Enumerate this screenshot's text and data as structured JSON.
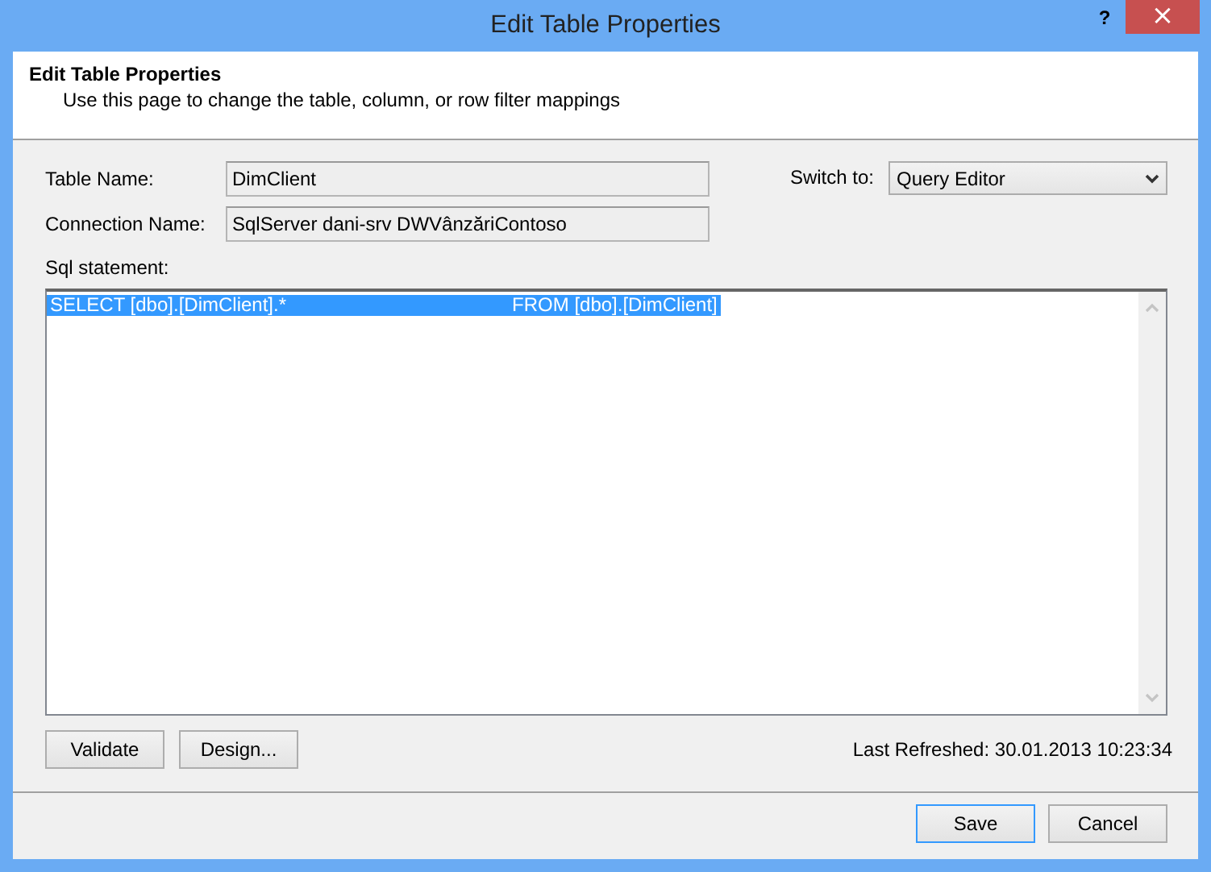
{
  "window": {
    "title": "Edit Table Properties",
    "help": "?",
    "close": "×"
  },
  "header": {
    "title": "Edit Table Properties",
    "subtitle": "Use this page to change the table, column, or row filter mappings"
  },
  "fields": [
    {
      "label": "Table Name:",
      "value": "DimClient"
    },
    {
      "label": "Connection Name:",
      "value": "SqlServer dani-srv DWVânzăriContoso"
    }
  ],
  "switch_to": {
    "label": "Switch to:",
    "value": "Query Editor"
  },
  "sql": {
    "label": "Sql statement:",
    "lines": [
      {
        "text": "SELECT [dbo].[DimClient].*                                          FROM [dbo].[DimClient]",
        "selected": true
      }
    ]
  },
  "buttons": [
    {
      "label": "Validate"
    },
    {
      "label": "Design..."
    }
  ],
  "last_refreshed": "Last Refreshed: 30.01.2013 10:23:34",
  "footer_buttons": [
    {
      "label": "Save",
      "default": true
    },
    {
      "label": "Cancel",
      "default": false
    }
  ]
}
